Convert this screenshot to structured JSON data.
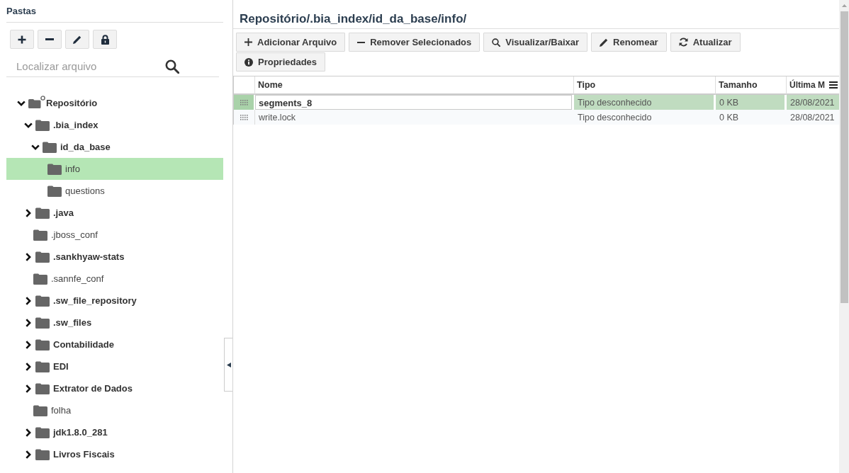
{
  "sidebar": {
    "title": "Pastas",
    "search": {
      "placeholder": "Localizar arquivo"
    },
    "tree": [
      {
        "label": "Repositório",
        "kind": "root",
        "expanded": true,
        "selected": false,
        "children": [
          {
            "label": ".bia_index",
            "kind": "folder",
            "expanded": true,
            "selected": false,
            "children": [
              {
                "label": "id_da_base",
                "kind": "folder",
                "expanded": true,
                "selected": false,
                "children": [
                  {
                    "label": "info",
                    "kind": "leaf",
                    "selected": true
                  },
                  {
                    "label": "questions",
                    "kind": "leaf",
                    "selected": false
                  }
                ]
              }
            ]
          },
          {
            "label": ".java",
            "kind": "folder",
            "expanded": false,
            "selected": false
          },
          {
            "label": ".jboss_conf",
            "kind": "leaf",
            "selected": false
          },
          {
            "label": ".sankhyaw-stats",
            "kind": "folder",
            "expanded": false,
            "selected": false
          },
          {
            "label": ".sannfe_conf",
            "kind": "leaf",
            "selected": false
          },
          {
            "label": ".sw_file_repository",
            "kind": "folder",
            "expanded": false,
            "selected": false
          },
          {
            "label": ".sw_files",
            "kind": "folder",
            "expanded": false,
            "selected": false
          },
          {
            "label": "Contabilidade",
            "kind": "folder",
            "expanded": false,
            "selected": false
          },
          {
            "label": "EDI",
            "kind": "folder",
            "expanded": false,
            "selected": false
          },
          {
            "label": "Extrator de Dados",
            "kind": "folder",
            "expanded": false,
            "selected": false
          },
          {
            "label": "folha",
            "kind": "leaf",
            "selected": false
          },
          {
            "label": "jdk1.8.0_281",
            "kind": "folder",
            "expanded": false,
            "selected": false
          },
          {
            "label": "Livros Fiscais",
            "kind": "folder",
            "expanded": false,
            "selected": false
          }
        ]
      }
    ]
  },
  "main": {
    "path": "Repositório/.bia_index/id_da_base/info/",
    "actions": [
      "Adicionar Arquivo",
      "Remover Selecionados",
      "Visualizar/Baixar",
      "Renomear",
      "Atualizar",
      "Propriedades"
    ],
    "table": {
      "columns": [
        "Nome",
        "Tipo",
        "Tamanho",
        "Última M"
      ],
      "rows": [
        {
          "selected": true,
          "editing": true,
          "cells": [
            "segments_8",
            "Tipo desconhecido",
            "0 KB",
            "28/08/2021"
          ]
        },
        {
          "selected": false,
          "editing": false,
          "cells": [
            "write.lock",
            "Tipo desconhecido",
            "0 KB",
            "28/08/2021"
          ]
        }
      ]
    }
  }
}
